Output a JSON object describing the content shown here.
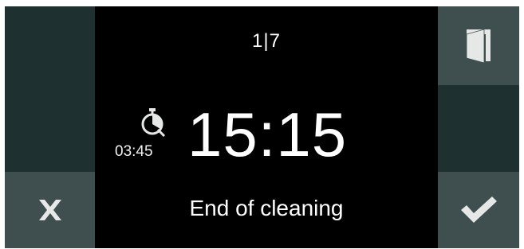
{
  "display": {
    "program_step": "1|7",
    "duration": "03:45",
    "end_time": "15:15",
    "status": "End of cleaning"
  },
  "buttons": {
    "cancel_icon": "close-icon",
    "confirm_icon": "checkmark-icon",
    "door_icon": "door-icon"
  },
  "colors": {
    "background": "#000000",
    "panel_dark": "#1f3030",
    "panel_light": "#3f4e4e",
    "icon_light": "#e6e8e8"
  }
}
